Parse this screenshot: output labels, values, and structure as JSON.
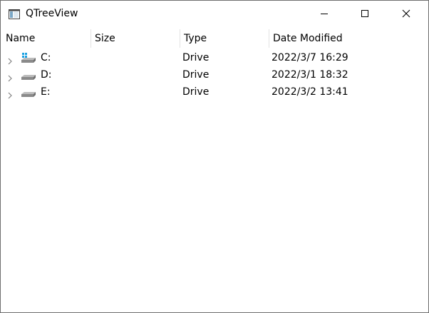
{
  "window": {
    "title": "QTreeView",
    "icons": {
      "app": "app-window-icon",
      "minimize": "minimize-icon",
      "maximize": "maximize-icon",
      "close": "close-icon"
    }
  },
  "tree": {
    "columns": [
      "Name",
      "Size",
      "Type",
      "Date Modified"
    ],
    "rows": [
      {
        "name": "C:",
        "size": "",
        "type": "Drive",
        "date": "2022/3/7 16:29",
        "icon": "windows-drive-icon"
      },
      {
        "name": "D:",
        "size": "",
        "type": "Drive",
        "date": "2022/3/1 18:32",
        "icon": "drive-icon"
      },
      {
        "name": "E:",
        "size": "",
        "type": "Drive",
        "date": "2022/3/2 13:41",
        "icon": "drive-icon"
      }
    ]
  }
}
